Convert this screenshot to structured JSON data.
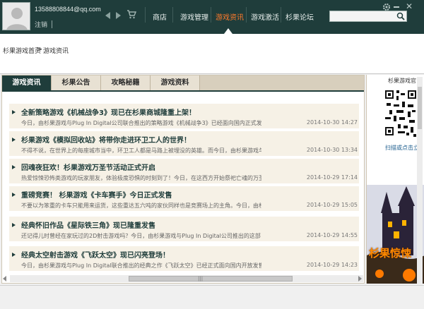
{
  "header": {
    "user_email": "13588808844@qq.com",
    "logout_label": "注销",
    "nav": [
      {
        "label": "商店"
      },
      {
        "label": "游戏管理"
      },
      {
        "label": "游戏资讯"
      },
      {
        "label": "游戏激活"
      },
      {
        "label": "杉果论坛"
      }
    ],
    "active_nav": "游戏资讯",
    "search": {
      "placeholder": "",
      "value": ""
    },
    "accent_color": "#ff7a2b",
    "bar_color": "#1f3d3b"
  },
  "breadcrumb": {
    "home": "杉果游戏首页",
    "separator": ">",
    "current": "游戏资讯"
  },
  "tabs": [
    {
      "label": "游戏资讯"
    },
    {
      "label": "杉果公告"
    },
    {
      "label": "攻略秘籍"
    },
    {
      "label": "游戏资料"
    }
  ],
  "news": [
    {
      "title": "全新策略游戏《机械战争3》现已在杉果商城隆重上架！",
      "summary": "今日，由杉果游戏与Plug In Digital公司联合推出的策略游戏《机械战争3》已经面向国内正式发售，...",
      "date": "2014-10-30 14:27"
    },
    {
      "title": "杉果游戏《模拟回收站》将带你走进环卫工人的世界！",
      "summary": "不得不说，在世界上的每座城市当中，环卫工人都是马路上被埋没的英雄。而今日，由杉果游戏与Plug...",
      "date": "2014-10-30 13:34"
    },
    {
      "title": "回魂夜狂欢！杉果游戏万圣节活动正式开启",
      "summary": "热爱惊悚恐怖类游戏的玩家朋友，体验极度恐惧的时刻到了！今日，在这西方开始祭祀亡魂的万圣时节...",
      "date": "2014-10-29 17:14"
    },
    {
      "title": "重磅竞赛！ 杉果游戏《卡车赛手》今日正式发售",
      "summary": "不要以为笨重的卡车只能用来运货，这些重达五六吨的家伙同样也是竞赛场上的主角。今日，由杉果游戏...",
      "date": "2014-10-29 15:05"
    },
    {
      "title": "经典怀旧作品《星际铁三角》现已隆重发售",
      "summary": "还记得儿时曾经在家玩过的2D射击游戏吗？今日，由杉果游戏与Plug In Digital公司推出的这部《星际铁三...",
      "date": "2014-10-29 14:55"
    },
    {
      "title": "经典太空射击游戏《飞跃太空》现已闪亮登场！",
      "summary": "今日，由杉果游戏与Plug In Digital联合推出的经典之作《飞跃太空》已经正式面向国内开放发售，售...",
      "date": "2014-10-29 14:23"
    }
  ],
  "side": {
    "title": "杉果游戏官",
    "scan_label": "扫描或点击立",
    "ad_label": "杉果惊悚"
  }
}
